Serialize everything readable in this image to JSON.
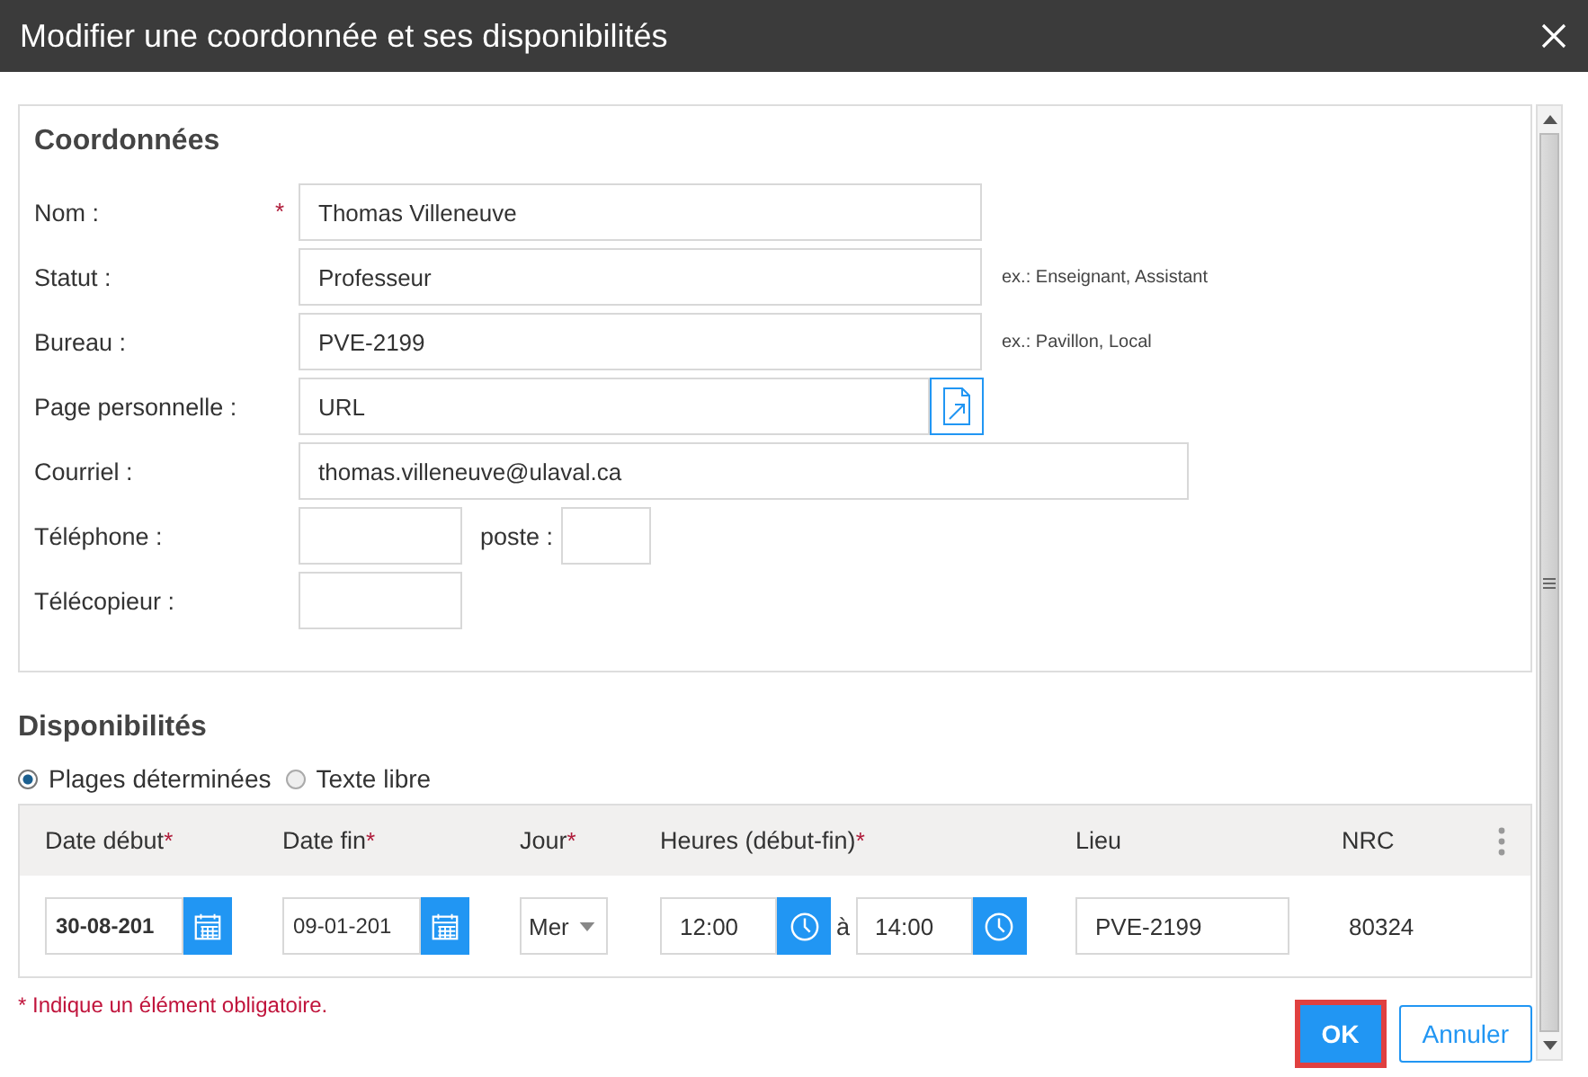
{
  "dialog": {
    "title": "Modifier une coordonnée et ses disponibilités"
  },
  "coordonnees": {
    "heading": "Coordonnées",
    "fields": [
      {
        "kind": "text",
        "label": "Nom :",
        "required_mark": "*",
        "value": "Thomas Villeneuve"
      },
      {
        "kind": "text",
        "label": "Statut :",
        "value": "Professeur",
        "hint": "ex.: Enseignant, Assistant"
      },
      {
        "kind": "text",
        "label": "Bureau :",
        "value": "PVE-2199",
        "hint": "ex.: Pavillon, Local"
      },
      {
        "kind": "link",
        "label": "Page personnelle :",
        "value": "URL"
      },
      {
        "kind": "email",
        "label": "Courriel :",
        "value": "thomas.villeneuve@ulaval.ca"
      },
      {
        "kind": "phone",
        "label": "Téléphone :",
        "extension_label": "poste :"
      },
      {
        "kind": "short",
        "label": "Télécopieur :"
      }
    ]
  },
  "disponibilites": {
    "heading": "Disponibilités",
    "modes": [
      {
        "label": "Plages déterminées",
        "selected": true
      },
      {
        "label": "Texte libre",
        "selected": false
      }
    ],
    "columns": [
      {
        "label": "Date début",
        "required_mark": "*"
      },
      {
        "label": "Date fin",
        "required_mark": "*"
      },
      {
        "label": "Jour",
        "required_mark": "*"
      },
      {
        "label": "Heures (début-fin)",
        "required_mark": "*"
      },
      {
        "label": "Lieu"
      },
      {
        "label": "NRC"
      }
    ],
    "rows": [
      {
        "date_debut": "30-08-201",
        "date_fin": "09-01-201",
        "jour": "Mer",
        "heure_debut": "12:00",
        "separator": "à",
        "heure_fin": "14:00",
        "lieu": "PVE-2199",
        "nrc": "80324"
      }
    ]
  },
  "note": "* Indique un élément obligatoire.",
  "buttons": [
    {
      "label": "OK",
      "kind": "primary",
      "focused": true
    },
    {
      "label": "Annuler",
      "kind": "secondary",
      "focused": false
    }
  ]
}
